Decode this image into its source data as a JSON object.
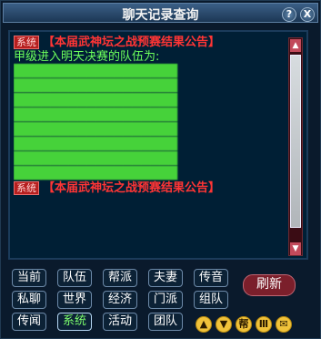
{
  "window": {
    "title": "聊天记录查询"
  },
  "titlebar_buttons": [
    "?",
    "X"
  ],
  "messages": [
    {
      "tag": "系统",
      "text": "【本届武神坛之战预赛结果公告】",
      "style": "red"
    },
    {
      "tag": "",
      "text": "甲级进入明天决赛的队伍为:",
      "style": "green"
    },
    {
      "tag": "",
      "text": "██████████████████",
      "style": "blurred"
    },
    {
      "tag": "",
      "text": "██████████████████",
      "style": "blurred"
    },
    {
      "tag": "",
      "text": "██████████████████",
      "style": "blurred"
    },
    {
      "tag": "",
      "text": "██████████████████",
      "style": "blurred"
    },
    {
      "tag": "",
      "text": "██████████████████",
      "style": "blurred"
    },
    {
      "tag": "",
      "text": "██████████████████",
      "style": "blurred"
    },
    {
      "tag": "",
      "text": "██████████████████",
      "style": "blurred"
    },
    {
      "tag": "",
      "text": "██████████████████",
      "style": "blurred"
    },
    {
      "tag": "系统",
      "text": "【本届武神坛之战预赛结果公告】",
      "style": "red"
    }
  ],
  "channels_row1": [
    "当前",
    "队伍",
    "帮派",
    "夫妻",
    "传音"
  ],
  "channels_row2": [
    "私聊",
    "世界",
    "经济",
    "门派",
    "组队"
  ],
  "channels_row3": [
    "传闻",
    "系统",
    "活动",
    "团队"
  ],
  "selected_channel": "系统",
  "refresh_label": "刷新",
  "bottom_icons": [
    "up-icon",
    "down-icon",
    "gang-icon",
    "bars-icon",
    "mail-icon"
  ]
}
